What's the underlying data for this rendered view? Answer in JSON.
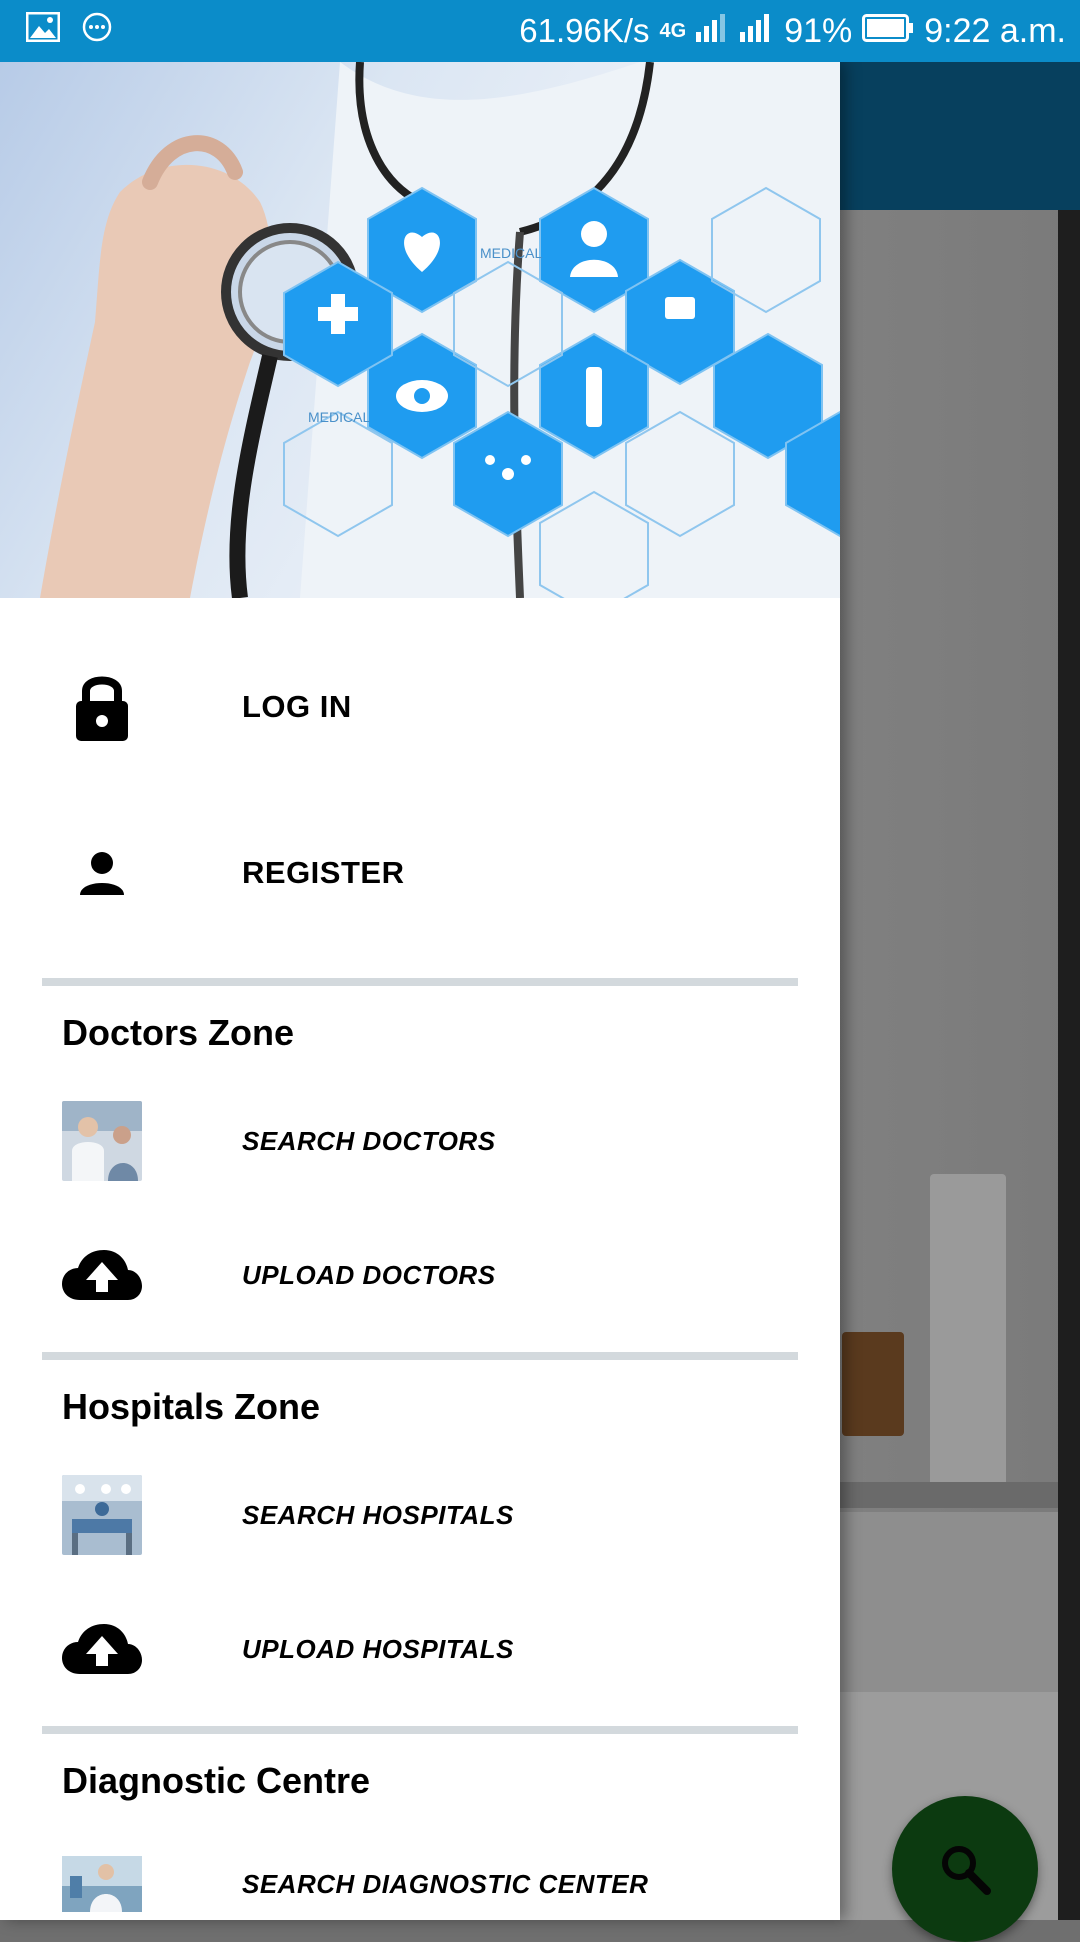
{
  "status_bar": {
    "speed": "61.96K/s",
    "network": "4G",
    "battery": "91%",
    "time": "9:22 a.m."
  },
  "drawer": {
    "account": [
      {
        "label": "LOG IN",
        "icon": "lock-icon"
      },
      {
        "label": "REGISTER",
        "icon": "person-icon"
      }
    ],
    "sections": [
      {
        "title": "Doctors Zone",
        "items": [
          {
            "label": "SEARCH DOCTORS",
            "icon": "doctor-photo-icon"
          },
          {
            "label": "UPLOAD DOCTORS",
            "icon": "cloud-upload-icon"
          }
        ]
      },
      {
        "title": "Hospitals Zone",
        "items": [
          {
            "label": "SEARCH HOSPITALS",
            "icon": "hospital-photo-icon"
          },
          {
            "label": "UPLOAD HOSPITALS",
            "icon": "cloud-upload-icon"
          }
        ]
      },
      {
        "title": "Diagnostic Centre",
        "items": [
          {
            "label": "SEARCH DIAGNOSTIC CENTER",
            "icon": "lab-photo-icon"
          }
        ]
      }
    ]
  },
  "header_image": {
    "overlay_text": [
      "MEDICAL",
      "MEDICAL"
    ]
  },
  "fab": {
    "icon": "search-icon"
  },
  "colors": {
    "status_bar": "#0b8cc9",
    "toolbar": "#07405e",
    "hex_blue": "#1f9cf0",
    "fab": "#0c3a10",
    "divider": "#d3d9dd"
  }
}
